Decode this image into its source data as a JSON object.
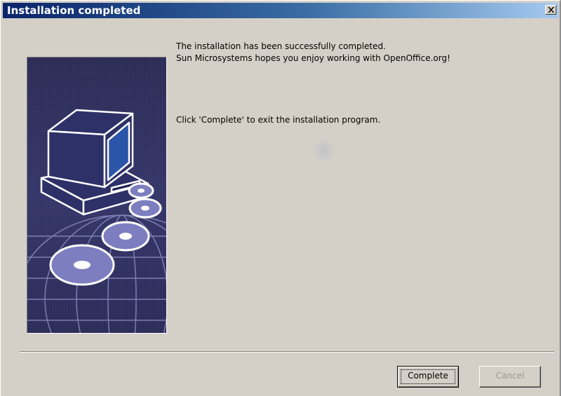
{
  "window": {
    "title": "Installation completed"
  },
  "message": {
    "line1": "The installation has been successfully completed.",
    "line2": "Sun Microsystems hopes you enjoy working with OpenOffice.org!",
    "line3": "Click 'Complete' to exit the installation program."
  },
  "buttons": {
    "complete": "Complete",
    "cancel": "Cancel"
  },
  "colors": {
    "titlebar_start": "#0a246a",
    "titlebar_end": "#a6caf0",
    "dialog_bg": "#d4d0c8",
    "banner_bg": "#2a2a55"
  },
  "icons": {
    "close": "close-icon",
    "banner": "computer-with-discs-illustration"
  }
}
